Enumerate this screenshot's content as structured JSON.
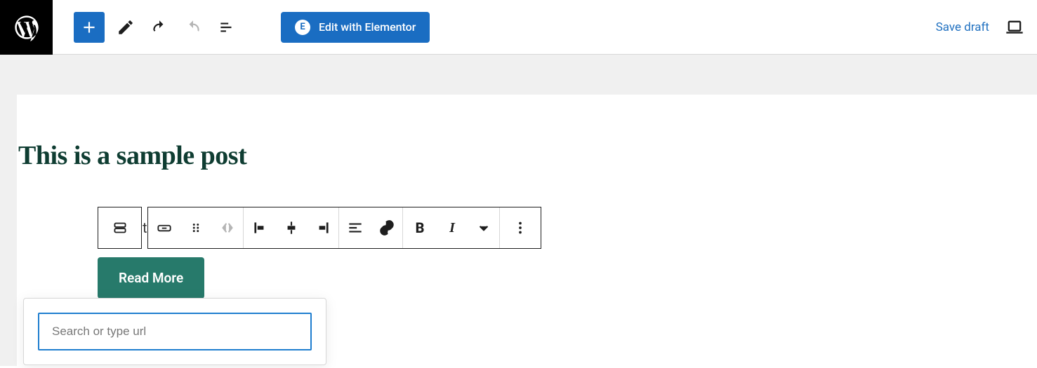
{
  "topbar": {
    "elementor_label": "Edit with Elementor",
    "elementor_badge": "E",
    "save_draft_label": "Save draft"
  },
  "post": {
    "title": "This is a sample post",
    "peek_text": "te"
  },
  "button_block": {
    "label": "Read More"
  },
  "link_popover": {
    "placeholder": "Search or type url",
    "value": ""
  }
}
